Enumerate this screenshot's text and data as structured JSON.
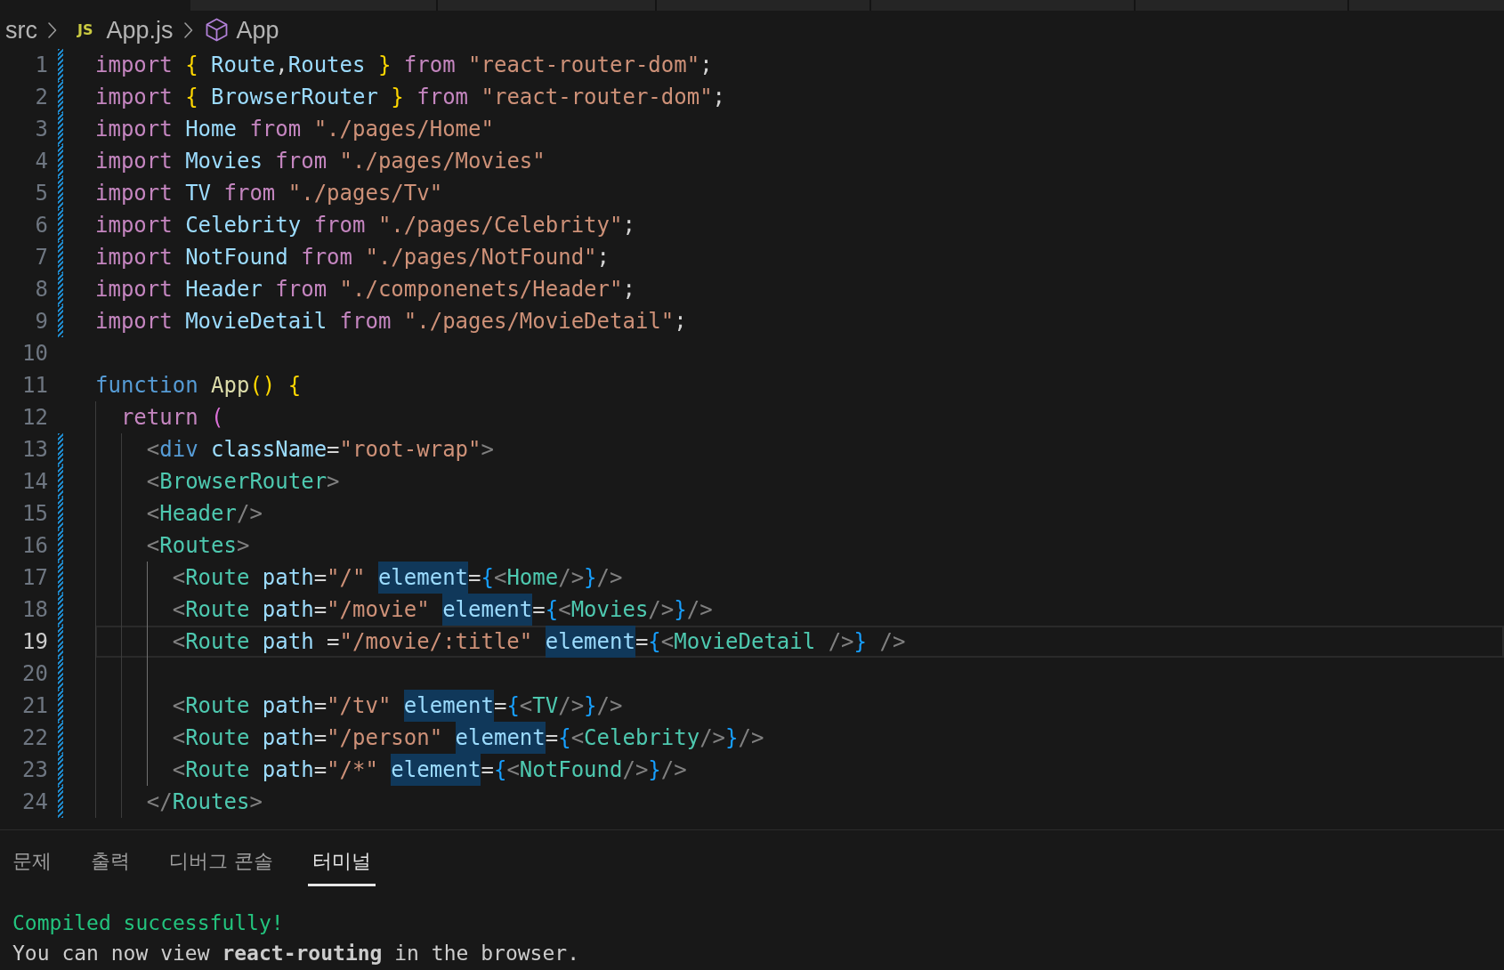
{
  "breadcrumb": [
    {
      "kind": "folder",
      "label": "src"
    },
    {
      "kind": "file",
      "label": "App.js",
      "icon_text": "JS"
    },
    {
      "kind": "symbol",
      "label": "App"
    }
  ],
  "lines": [
    {
      "number": "1",
      "modified": true,
      "current": false,
      "tokens": [
        {
          "kind": "keyword",
          "text": "import"
        },
        {
          "kind": "bracket1",
          "text": " {"
        },
        {
          "kind": "name",
          "text": " Route"
        },
        {
          "kind": "plain",
          "text": ","
        },
        {
          "kind": "name",
          "text": "Routes"
        },
        {
          "kind": "bracket1",
          "text": " }"
        },
        {
          "kind": "keyword",
          "text": " from"
        },
        {
          "kind": "string",
          "text": " \"react-router-dom\""
        },
        {
          "kind": "plain",
          "text": ";"
        }
      ]
    },
    {
      "number": "2",
      "modified": true,
      "current": false,
      "tokens": [
        {
          "kind": "keyword",
          "text": "import"
        },
        {
          "kind": "bracket1",
          "text": " {"
        },
        {
          "kind": "name",
          "text": " BrowserRouter"
        },
        {
          "kind": "bracket1",
          "text": " }"
        },
        {
          "kind": "keyword",
          "text": " from"
        },
        {
          "kind": "string",
          "text": " \"react-router-dom\""
        },
        {
          "kind": "plain",
          "text": ";"
        }
      ]
    },
    {
      "number": "3",
      "modified": true,
      "current": false,
      "tokens": [
        {
          "kind": "keyword",
          "text": "import"
        },
        {
          "kind": "name",
          "text": " Home"
        },
        {
          "kind": "keyword",
          "text": " from"
        },
        {
          "kind": "string",
          "text": " \"./pages/Home\""
        }
      ]
    },
    {
      "number": "4",
      "modified": true,
      "current": false,
      "tokens": [
        {
          "kind": "keyword",
          "text": "import"
        },
        {
          "kind": "name",
          "text": " Movies"
        },
        {
          "kind": "keyword",
          "text": " from"
        },
        {
          "kind": "string",
          "text": " \"./pages/Movies\""
        }
      ]
    },
    {
      "number": "5",
      "modified": true,
      "current": false,
      "tokens": [
        {
          "kind": "keyword",
          "text": "import"
        },
        {
          "kind": "name",
          "text": " TV"
        },
        {
          "kind": "keyword",
          "text": " from"
        },
        {
          "kind": "string",
          "text": " \"./pages/Tv\""
        }
      ]
    },
    {
      "number": "6",
      "modified": true,
      "current": false,
      "tokens": [
        {
          "kind": "keyword",
          "text": "import"
        },
        {
          "kind": "name",
          "text": " Celebrity"
        },
        {
          "kind": "keyword",
          "text": " from"
        },
        {
          "kind": "string",
          "text": " \"./pages/Celebrity\""
        },
        {
          "kind": "plain",
          "text": ";"
        }
      ]
    },
    {
      "number": "7",
      "modified": true,
      "current": false,
      "tokens": [
        {
          "kind": "keyword",
          "text": "import"
        },
        {
          "kind": "name",
          "text": " NotFound"
        },
        {
          "kind": "keyword",
          "text": " from"
        },
        {
          "kind": "string",
          "text": " \"./pages/NotFound\""
        },
        {
          "kind": "plain",
          "text": ";"
        }
      ]
    },
    {
      "number": "8",
      "modified": true,
      "current": false,
      "tokens": [
        {
          "kind": "keyword",
          "text": "import"
        },
        {
          "kind": "name",
          "text": " Header"
        },
        {
          "kind": "keyword",
          "text": " from"
        },
        {
          "kind": "string",
          "text": " \"./componenets/Header\""
        },
        {
          "kind": "plain",
          "text": ";"
        }
      ]
    },
    {
      "number": "9",
      "modified": true,
      "current": false,
      "tokens": [
        {
          "kind": "keyword",
          "text": "import"
        },
        {
          "kind": "name",
          "text": " MovieDetail"
        },
        {
          "kind": "keyword",
          "text": " from"
        },
        {
          "kind": "string",
          "text": " \"./pages/MovieDetail\""
        },
        {
          "kind": "plain",
          "text": ";"
        }
      ]
    },
    {
      "number": "10",
      "modified": false,
      "current": false
    },
    {
      "number": "11",
      "modified": false,
      "current": false,
      "tokens": [
        {
          "kind": "storage",
          "text": "function"
        },
        {
          "kind": "func",
          "text": " App"
        },
        {
          "kind": "bracket1",
          "text": "("
        },
        {
          "kind": "bracket1",
          "text": ")"
        },
        {
          "kind": "bracket1",
          "text": " {"
        }
      ]
    },
    {
      "number": "12",
      "modified": false,
      "current": false,
      "tokens": [
        {
          "kind": "keyword",
          "text": "  return"
        },
        {
          "kind": "bracket2",
          "text": " ("
        }
      ]
    },
    {
      "number": "13",
      "modified": true,
      "current": false,
      "tokens": [
        {
          "kind": "punct",
          "text": "    <"
        },
        {
          "kind": "tag",
          "text": "div"
        },
        {
          "kind": "name",
          "text": " className"
        },
        {
          "kind": "plain",
          "text": "="
        },
        {
          "kind": "string",
          "text": "\"root-wrap\""
        },
        {
          "kind": "punct",
          "text": ">"
        }
      ]
    },
    {
      "number": "14",
      "modified": true,
      "current": false,
      "tokens": [
        {
          "kind": "punct",
          "text": "    <"
        },
        {
          "kind": "component",
          "text": "BrowserRouter"
        },
        {
          "kind": "punct",
          "text": ">"
        }
      ]
    },
    {
      "number": "15",
      "modified": true,
      "current": false,
      "tokens": [
        {
          "kind": "punct",
          "text": "    <"
        },
        {
          "kind": "component",
          "text": "Header"
        },
        {
          "kind": "punct",
          "text": "/>"
        }
      ]
    },
    {
      "number": "16",
      "modified": true,
      "current": false,
      "tokens": [
        {
          "kind": "punct",
          "text": "    <"
        },
        {
          "kind": "component",
          "text": "Routes"
        },
        {
          "kind": "punct",
          "text": ">"
        }
      ]
    },
    {
      "number": "17",
      "modified": true,
      "current": false,
      "tokens": [
        {
          "kind": "punct",
          "text": "      <"
        },
        {
          "kind": "component",
          "text": "Route"
        },
        {
          "kind": "name",
          "text": " path"
        },
        {
          "kind": "plain",
          "text": "="
        },
        {
          "kind": "string",
          "text": "\"/\""
        },
        {
          "kind": "match",
          "text": " element"
        },
        {
          "kind": "plain",
          "text": "="
        },
        {
          "kind": "bracket3",
          "text": "{"
        },
        {
          "kind": "punct",
          "text": "<"
        },
        {
          "kind": "component",
          "text": "Home"
        },
        {
          "kind": "punct",
          "text": "/>"
        },
        {
          "kind": "bracket3",
          "text": "}"
        },
        {
          "kind": "punct",
          "text": "/>"
        }
      ]
    },
    {
      "number": "18",
      "modified": true,
      "current": false,
      "tokens": [
        {
          "kind": "punct",
          "text": "      <"
        },
        {
          "kind": "component",
          "text": "Route"
        },
        {
          "kind": "name",
          "text": " path"
        },
        {
          "kind": "plain",
          "text": "="
        },
        {
          "kind": "string",
          "text": "\"/movie\""
        },
        {
          "kind": "match",
          "text": " element"
        },
        {
          "kind": "plain",
          "text": "="
        },
        {
          "kind": "bracket3",
          "text": "{"
        },
        {
          "kind": "punct",
          "text": "<"
        },
        {
          "kind": "component",
          "text": "Movies"
        },
        {
          "kind": "punct",
          "text": "/>"
        },
        {
          "kind": "bracket3",
          "text": "}"
        },
        {
          "kind": "punct",
          "text": "/>"
        }
      ]
    },
    {
      "number": "19",
      "modified": true,
      "current": true,
      "tokens": [
        {
          "kind": "punct",
          "text": "      <"
        },
        {
          "kind": "component",
          "text": "Route"
        },
        {
          "kind": "name",
          "text": " path"
        },
        {
          "kind": "plain",
          "text": " ="
        },
        {
          "kind": "string",
          "text": "\"/movie/:title\""
        },
        {
          "kind": "match",
          "text": " element"
        },
        {
          "kind": "plain",
          "text": "="
        },
        {
          "kind": "bracket3",
          "text": "{"
        },
        {
          "kind": "punct",
          "text": "<"
        },
        {
          "kind": "component",
          "text": "MovieDetail"
        },
        {
          "kind": "punct",
          "text": " />"
        },
        {
          "kind": "bracket3",
          "text": "}"
        },
        {
          "kind": "punct",
          "text": " />"
        }
      ]
    },
    {
      "number": "20",
      "modified": true,
      "current": false
    },
    {
      "number": "21",
      "modified": true,
      "current": false,
      "tokens": [
        {
          "kind": "punct",
          "text": "      <"
        },
        {
          "kind": "component",
          "text": "Route"
        },
        {
          "kind": "name",
          "text": " path"
        },
        {
          "kind": "plain",
          "text": "="
        },
        {
          "kind": "string",
          "text": "\"/tv\""
        },
        {
          "kind": "match",
          "text": " element"
        },
        {
          "kind": "plain",
          "text": "="
        },
        {
          "kind": "bracket3",
          "text": "{"
        },
        {
          "kind": "punct",
          "text": "<"
        },
        {
          "kind": "component",
          "text": "TV"
        },
        {
          "kind": "punct",
          "text": "/>"
        },
        {
          "kind": "bracket3",
          "text": "}"
        },
        {
          "kind": "punct",
          "text": "/>"
        }
      ]
    },
    {
      "number": "22",
      "modified": true,
      "current": false,
      "tokens": [
        {
          "kind": "punct",
          "text": "      <"
        },
        {
          "kind": "component",
          "text": "Route"
        },
        {
          "kind": "name",
          "text": " path"
        },
        {
          "kind": "plain",
          "text": "="
        },
        {
          "kind": "string",
          "text": "\"/person\""
        },
        {
          "kind": "match",
          "text": " element"
        },
        {
          "kind": "plain",
          "text": "="
        },
        {
          "kind": "bracket3",
          "text": "{"
        },
        {
          "kind": "punct",
          "text": "<"
        },
        {
          "kind": "component",
          "text": "Celebrity"
        },
        {
          "kind": "punct",
          "text": "/>"
        },
        {
          "kind": "bracket3",
          "text": "}"
        },
        {
          "kind": "punct",
          "text": "/>"
        }
      ]
    },
    {
      "number": "23",
      "modified": true,
      "current": false,
      "tokens": [
        {
          "kind": "punct",
          "text": "      <"
        },
        {
          "kind": "component",
          "text": "Route"
        },
        {
          "kind": "name",
          "text": " path"
        },
        {
          "kind": "plain",
          "text": "="
        },
        {
          "kind": "string",
          "text": "\"/*\""
        },
        {
          "kind": "match",
          "text": " element"
        },
        {
          "kind": "plain",
          "text": "="
        },
        {
          "kind": "bracket3",
          "text": "{"
        },
        {
          "kind": "punct",
          "text": "<"
        },
        {
          "kind": "component",
          "text": "NotFound"
        },
        {
          "kind": "punct",
          "text": "/>"
        },
        {
          "kind": "bracket3",
          "text": "}"
        },
        {
          "kind": "punct",
          "text": "/>"
        }
      ]
    },
    {
      "number": "24",
      "modified": true,
      "current": false,
      "tokens": [
        {
          "kind": "punct",
          "text": "    </"
        },
        {
          "kind": "component",
          "text": "Routes"
        },
        {
          "kind": "punct",
          "text": ">"
        }
      ]
    }
  ],
  "panel": {
    "tabs": [
      {
        "label": "문제",
        "selected": false
      },
      {
        "label": "출력",
        "selected": false
      },
      {
        "label": "디버그 콘솔",
        "selected": false
      },
      {
        "label": "터미널",
        "selected": true
      }
    ],
    "terminal": [
      {
        "kind": "success",
        "text": "Compiled successfully!"
      },
      {
        "kind": "plain",
        "text": "You can now view **react-routing** in the browser."
      }
    ]
  }
}
